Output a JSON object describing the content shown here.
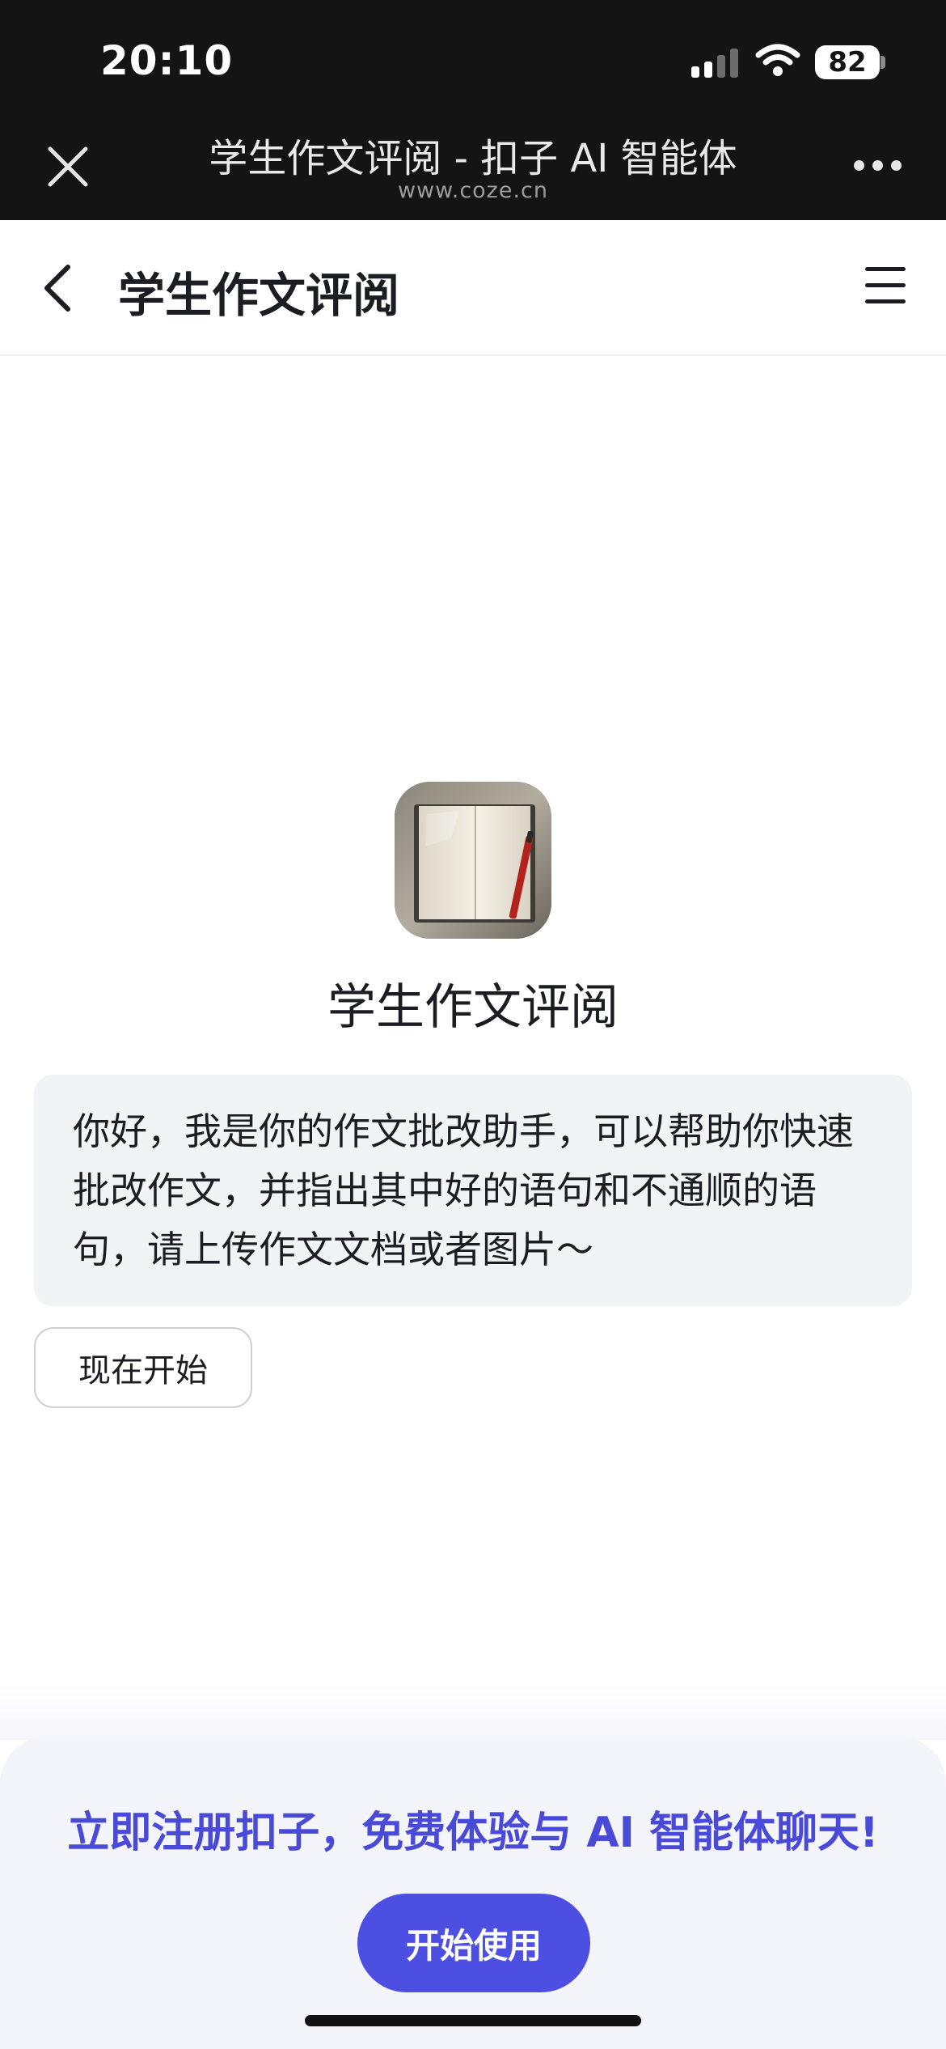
{
  "status_bar": {
    "time": "20:10",
    "battery": "82",
    "icons": [
      "cellular-signal-icon",
      "wifi-icon",
      "battery-icon"
    ]
  },
  "browser": {
    "title": "学生作文评阅 - 扣子 AI 智能体",
    "url": "www.coze.cn",
    "icons": [
      "close-icon",
      "more-dots-icon"
    ]
  },
  "header": {
    "title": "学生作文评阅",
    "icons": [
      "chevron-left-icon",
      "menu-icon"
    ]
  },
  "bot": {
    "name": "学生作文评阅",
    "avatar_icon": "open-book-with-pen-icon",
    "greeting": "你好，我是你的作文批改助手，可以帮助你快速批改作文，并指出其中好的语句和不通顺的语句，请上传作文文档或者图片～",
    "start_button": "现在开始"
  },
  "register": {
    "text": "立即注册扣子，免费体验与 AI 智能体聊天!",
    "button": "开始使用"
  },
  "colors": {
    "accent": "#4d4fe3",
    "accent_text": "#4a4ad8",
    "chrome_bg": "#141414",
    "bubble_bg": "#f2f3f5",
    "panel_bg": "#f4f4fb"
  }
}
